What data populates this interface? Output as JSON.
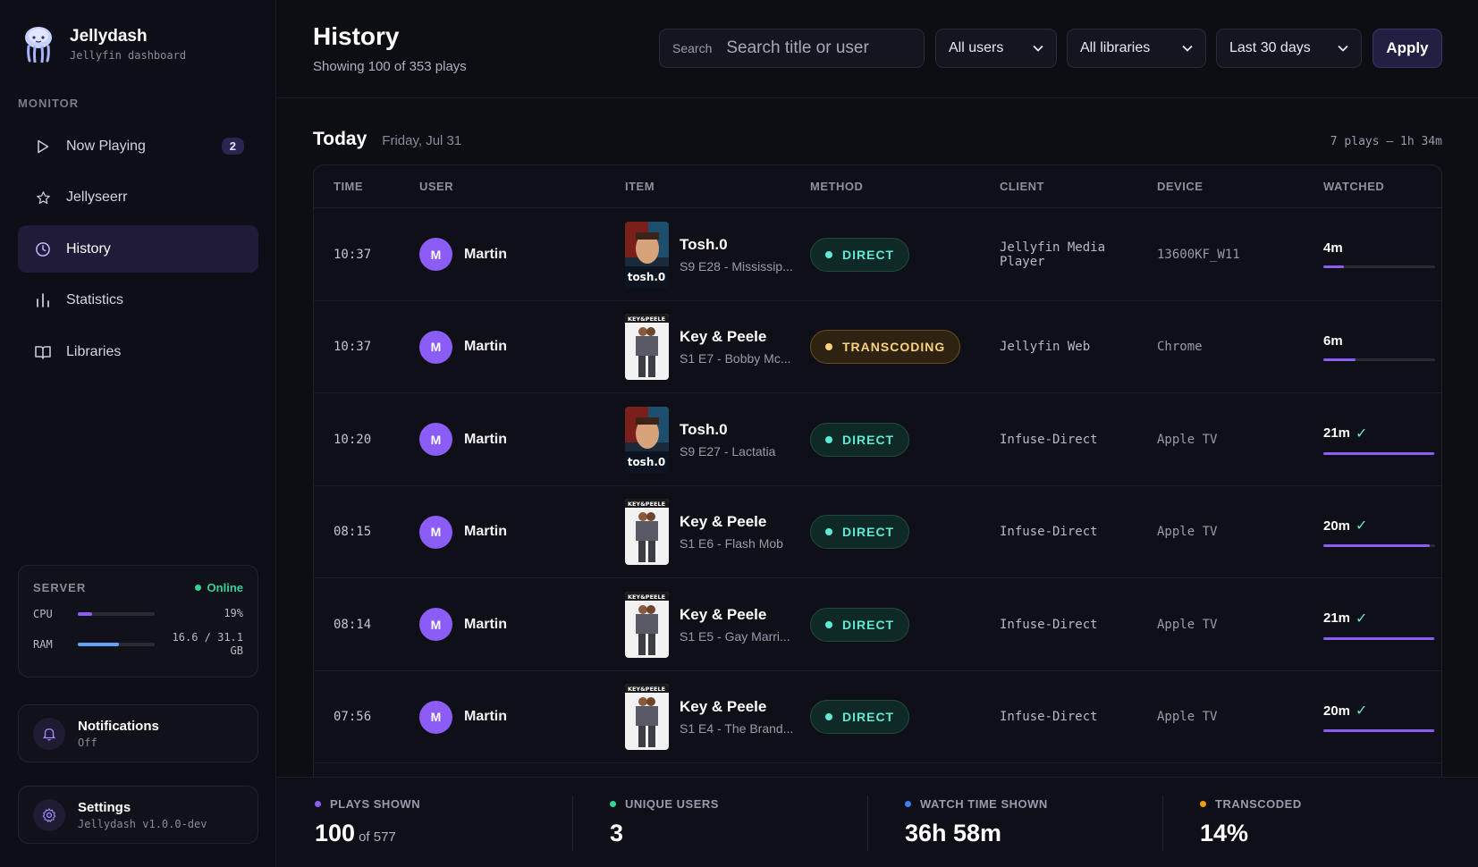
{
  "app": {
    "name": "Jellydash",
    "subtitle": "Jellyfin dashboard"
  },
  "sidebar": {
    "section_label": "MONITOR",
    "items": [
      {
        "label": "Now Playing",
        "icon": "play-icon",
        "badge": "2",
        "active": false
      },
      {
        "label": "Jellyseerr",
        "icon": "star-icon",
        "active": false
      },
      {
        "label": "History",
        "icon": "clock-icon",
        "active": true
      },
      {
        "label": "Statistics",
        "icon": "bar-chart-icon",
        "active": false
      },
      {
        "label": "Libraries",
        "icon": "book-icon",
        "active": false
      }
    ],
    "server": {
      "title": "SERVER",
      "status": "Online",
      "cpu_label": "CPU",
      "cpu_value": "19%",
      "cpu_fraction": 0.19,
      "ram_label": "RAM",
      "ram_value": "16.6 / 31.1 GB",
      "ram_fraction": 0.53
    },
    "notifications": {
      "title": "Notifications",
      "status": "Off"
    },
    "settings": {
      "title": "Settings",
      "version": "Jellydash v1.0.0-dev"
    }
  },
  "header": {
    "title": "History",
    "subtitle": "Showing 100 of 353 plays",
    "search_label": "Search",
    "search_placeholder": "Search title or user",
    "filters": {
      "users": "All users",
      "libraries": "All libraries",
      "range": "Last 30 days"
    },
    "apply_label": "Apply"
  },
  "day": {
    "title": "Today",
    "date": "Friday, Jul 31",
    "summary": "7 plays — 1h 34m"
  },
  "table": {
    "columns": [
      "TIME",
      "USER",
      "ITEM",
      "METHOD",
      "CLIENT",
      "DEVICE",
      "WATCHED"
    ],
    "rows": [
      {
        "time": "10:37",
        "avatar": "M",
        "user": "Martin",
        "title": "Tosh.0",
        "sub": "S9 E28 - Mississip...",
        "poster": "tosh",
        "method": "DIRECT",
        "client": "Jellyfin Media Player",
        "device": "13600KF_W11",
        "watched": "4m",
        "complete": false,
        "progress": 0.18
      },
      {
        "time": "10:37",
        "avatar": "M",
        "user": "Martin",
        "title": "Key & Peele",
        "sub": "S1 E7 - Bobby Mc...",
        "poster": "kp",
        "method": "TRANSCODING",
        "client": "Jellyfin Web",
        "device": "Chrome",
        "watched": "6m",
        "complete": false,
        "progress": 0.29
      },
      {
        "time": "10:20",
        "avatar": "M",
        "user": "Martin",
        "title": "Tosh.0",
        "sub": "S9 E27 - Lactatia",
        "poster": "tosh",
        "method": "DIRECT",
        "client": "Infuse-Direct",
        "device": "Apple TV",
        "watched": "21m",
        "complete": true,
        "progress": 0.99
      },
      {
        "time": "08:15",
        "avatar": "M",
        "user": "Martin",
        "title": "Key & Peele",
        "sub": "S1 E6 - Flash Mob",
        "poster": "kp",
        "method": "DIRECT",
        "client": "Infuse-Direct",
        "device": "Apple TV",
        "watched": "20m",
        "complete": true,
        "progress": 0.95
      },
      {
        "time": "08:14",
        "avatar": "M",
        "user": "Martin",
        "title": "Key & Peele",
        "sub": "S1 E5 - Gay Marri...",
        "poster": "kp",
        "method": "DIRECT",
        "client": "Infuse-Direct",
        "device": "Apple TV",
        "watched": "21m",
        "complete": true,
        "progress": 0.99
      },
      {
        "time": "07:56",
        "avatar": "M",
        "user": "Martin",
        "title": "Key & Peele",
        "sub": "S1 E4 - The Brand...",
        "poster": "kp",
        "method": "DIRECT",
        "client": "Infuse-Direct",
        "device": "Apple TV",
        "watched": "20m",
        "complete": true,
        "progress": 0.99
      }
    ]
  },
  "stats": [
    {
      "label": "PLAYS SHOWN",
      "value": "100",
      "suffix": "of 577",
      "color": "#8b5cf6"
    },
    {
      "label": "UNIQUE USERS",
      "value": "3",
      "suffix": "",
      "color": "#34d399"
    },
    {
      "label": "WATCH TIME SHOWN",
      "value": "36h 58m",
      "suffix": "",
      "color": "#3b82f6"
    },
    {
      "label": "TRANSCODED",
      "value": "14%",
      "suffix": "",
      "color": "#f59e0b"
    }
  ],
  "colors": {
    "accent": "#8b5cf6",
    "direct": "#5eead4",
    "transcoding": "#fcd27a",
    "online": "#34d399",
    "ram": "#60a5fa"
  }
}
